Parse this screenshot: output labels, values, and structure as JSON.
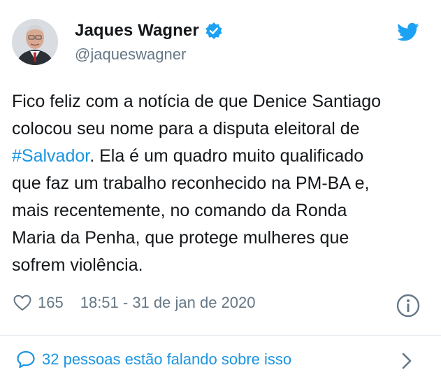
{
  "author": {
    "name": "Jaques Wagner",
    "handle": "@jaqueswagner"
  },
  "tweet": {
    "text_before": "Fico feliz com a notícia de que Denice Santiago\ncolocou seu nome para a disputa eleitoral de\n",
    "hashtag": "#Salvador",
    "text_after": ". Ela é um quadro muito qualificado\nque faz um trabalho reconhecido na PM-BA e,\nmais recentemente, no comando da Ronda\nMaria da Penha, que protege mulheres que\nsofrem violência."
  },
  "stats": {
    "likes": "165",
    "timestamp": "18:51 - 31 de jan de 2020"
  },
  "footer": {
    "talking": "32 pessoas estão falando sobre isso"
  },
  "icons": {
    "verified": "verified-badge-icon",
    "twitter": "twitter-bird-icon",
    "like": "heart-icon",
    "info": "info-icon",
    "reply": "speech-bubble-icon",
    "more": "chevron-right-icon"
  },
  "colors": {
    "accent": "#1b95e0",
    "text": "#14171a",
    "muted": "#657786",
    "twitter_blue": "#1da1f2"
  }
}
